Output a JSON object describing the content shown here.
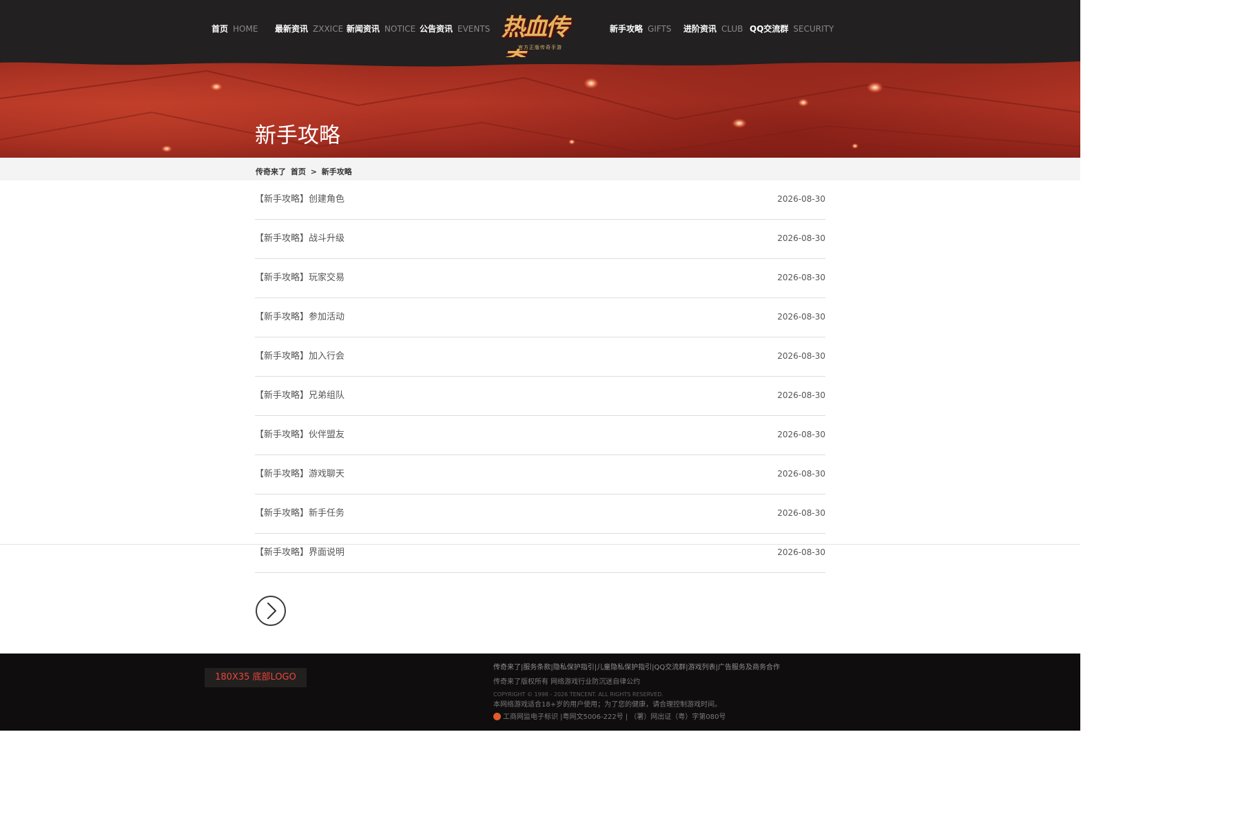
{
  "nav": {
    "left": [
      {
        "cn": "首页",
        "en": "HOME"
      },
      {
        "cn": "最新资讯",
        "en": "ZXXICE"
      },
      {
        "cn": "新闻资讯",
        "en": "NOTICE"
      },
      {
        "cn": "公告资讯",
        "en": "EVENTS"
      }
    ],
    "right": [
      {
        "cn": "新手攻略",
        "en": "GIFTS"
      },
      {
        "cn": "进阶资讯",
        "en": "CLUB"
      },
      {
        "cn": "QQ交流群",
        "en": "SECURITY"
      }
    ],
    "logo_text": "热血传奇",
    "logo_subtext": "官方正版传奇手游"
  },
  "banner": {
    "title": "新手攻略"
  },
  "breadcrumb": {
    "site": "传奇来了",
    "home": "首页",
    "separator": ">",
    "current": "新手攻略"
  },
  "articles": [
    {
      "title": "【新手攻略】创建角色",
      "date": "2026-08-30"
    },
    {
      "title": "【新手攻略】战斗升级",
      "date": "2026-08-30"
    },
    {
      "title": "【新手攻略】玩家交易",
      "date": "2026-08-30"
    },
    {
      "title": "【新手攻略】参加活动",
      "date": "2026-08-30"
    },
    {
      "title": "【新手攻略】加入行会",
      "date": "2026-08-30"
    },
    {
      "title": "【新手攻略】兄弟组队",
      "date": "2026-08-30"
    },
    {
      "title": "【新手攻略】伙伴盟友",
      "date": "2026-08-30"
    },
    {
      "title": "【新手攻略】游戏聊天",
      "date": "2026-08-30"
    },
    {
      "title": "【新手攻略】新手任务",
      "date": "2026-08-30"
    },
    {
      "title": "【新手攻略】界面说明",
      "date": "2026-08-30"
    }
  ],
  "pagination": {
    "next_icon": "chevron-right-icon"
  },
  "footer": {
    "logo_placeholder": "180X35 底部LOGO",
    "links": "传奇来了|服务条款|隐私保护指引|儿童隐私保护指引|QQ交流群|游戏列表|广告服务及商务合作",
    "copyright_cn": "传奇来了版权所有   网络游戏行业防沉迷自律公约",
    "copyright_en": "COPYRIGHT © 1998 - 2026 TENCENT. ALL RIGHTS RESERVED.",
    "notice": "本网络游戏适合18+岁的用户使用；为了您的健康，请合理控制游戏时间。",
    "license": "工商网监电子标识 |粤网文5006-222号 | （署）网出证（粤）字第080号"
  },
  "colors": {
    "topbar": "#222020",
    "banner": "#b43626",
    "footer": "#0f0d0d",
    "footer_logo_text": "#e7463b"
  }
}
